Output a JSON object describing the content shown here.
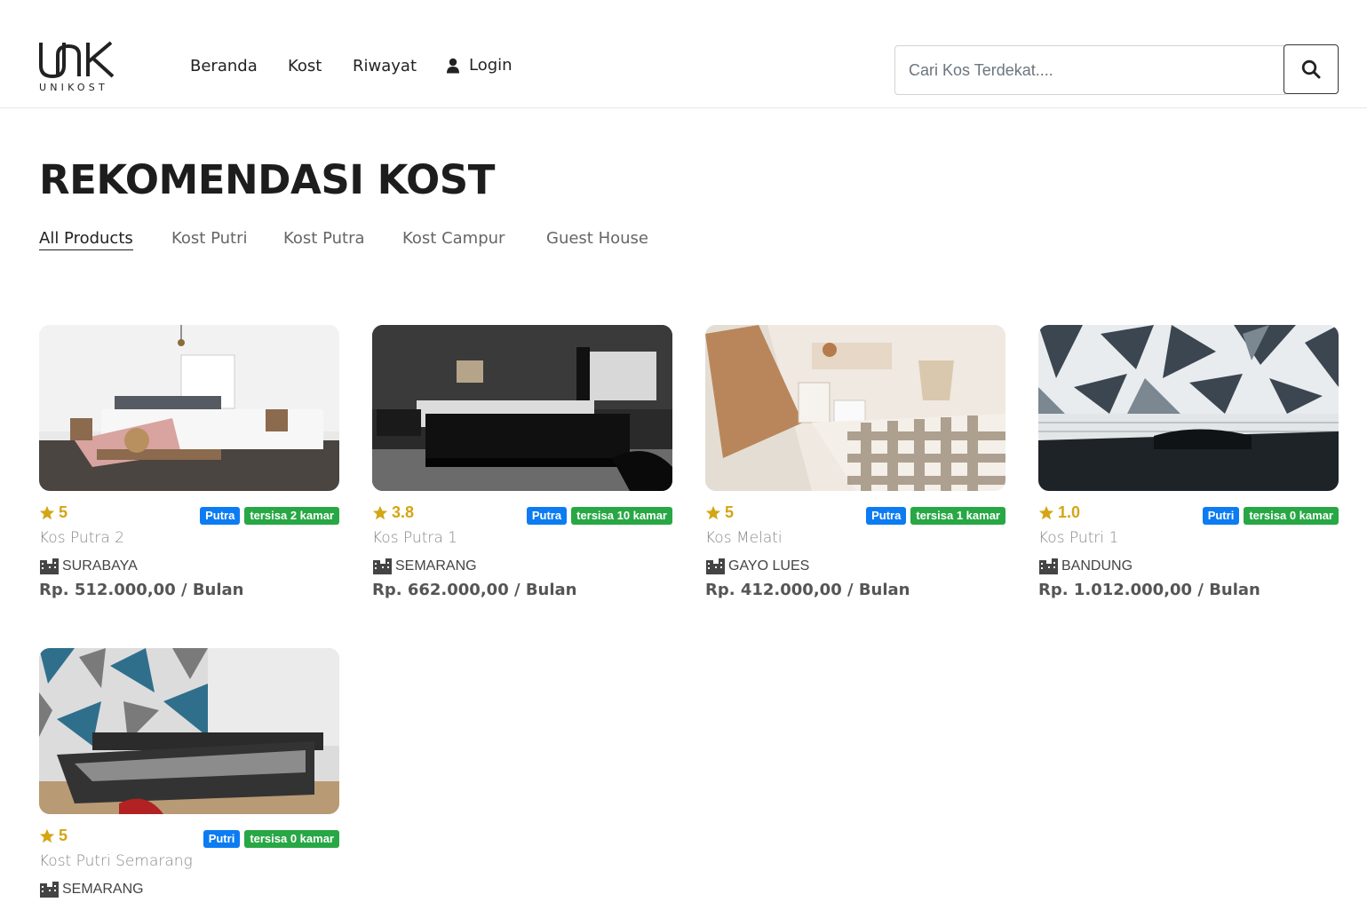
{
  "brand": {
    "logo_mark": "UNK",
    "logo_text": "UNIKOST"
  },
  "nav": {
    "items": [
      "Beranda",
      "Kost",
      "Riwayat"
    ],
    "login_label": "Login",
    "login_icon": "user-icon"
  },
  "search": {
    "placeholder": "Cari Kos Terdekat....",
    "icon": "search-icon"
  },
  "page": {
    "title": "REKOMENDASI KOST"
  },
  "filters": [
    "All Products",
    "Kost Putri",
    "Kost Putra",
    "Kost Campur",
    "Guest House"
  ],
  "active_filter": "All Products",
  "colors": {
    "star": "#d4a514",
    "badge_type": "#0d7cf2",
    "badge_rooms": "#28a745"
  },
  "cards": [
    {
      "rating": "5",
      "type": "Putra",
      "rooms": "tersisa 2 kamar",
      "name": "Kos Putra 2",
      "city": "SURABAYA",
      "price": "Rp. 512.000,00 / Bulan"
    },
    {
      "rating": "3.8",
      "type": "Putra",
      "rooms": "tersisa 10 kamar",
      "name": "Kos Putra 1",
      "city": "SEMARANG",
      "price": "Rp. 662.000,00 / Bulan"
    },
    {
      "rating": "5",
      "type": "Putra",
      "rooms": "tersisa 1 kamar",
      "name": "Kos Melati",
      "city": "GAYO LUES",
      "price": "Rp. 412.000,00 / Bulan"
    },
    {
      "rating": "1.0",
      "type": "Putri",
      "rooms": "tersisa 0 kamar",
      "name": "Kos Putri 1",
      "city": "BANDUNG",
      "price": "Rp. 1.012.000,00 / Bulan"
    },
    {
      "rating": "5",
      "type": "Putri",
      "rooms": "tersisa 0 kamar",
      "name": "Kost Putri Semarang",
      "city": "SEMARANG",
      "price": ""
    }
  ]
}
